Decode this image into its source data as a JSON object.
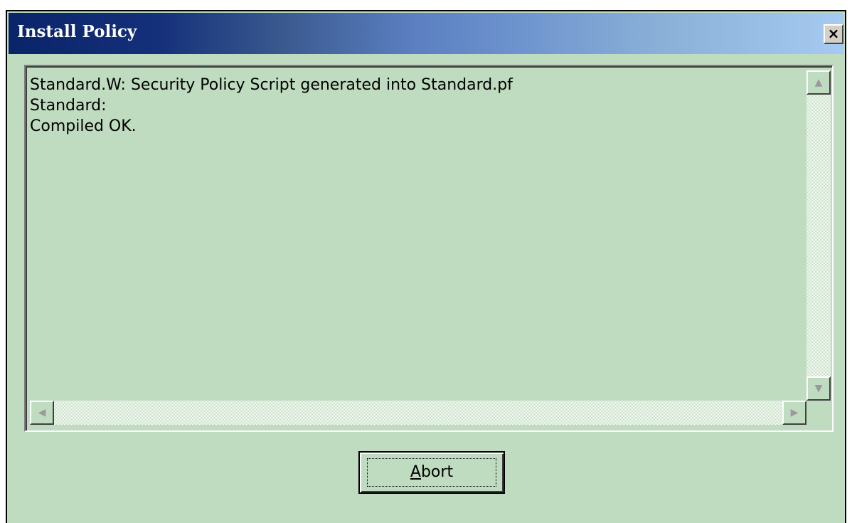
{
  "window": {
    "title": "Install Policy",
    "close_label": "×"
  },
  "log": {
    "lines": [
      "Standard.W: Security Policy Script generated into Standard.pf",
      "Standard:",
      "Compiled OK."
    ]
  },
  "scrollbars": {
    "up_arrow": "▲",
    "down_arrow": "▼",
    "left_arrow": "◀",
    "right_arrow": "▶"
  },
  "buttons": {
    "abort_mnemonic": "A",
    "abort_rest": "bort"
  }
}
